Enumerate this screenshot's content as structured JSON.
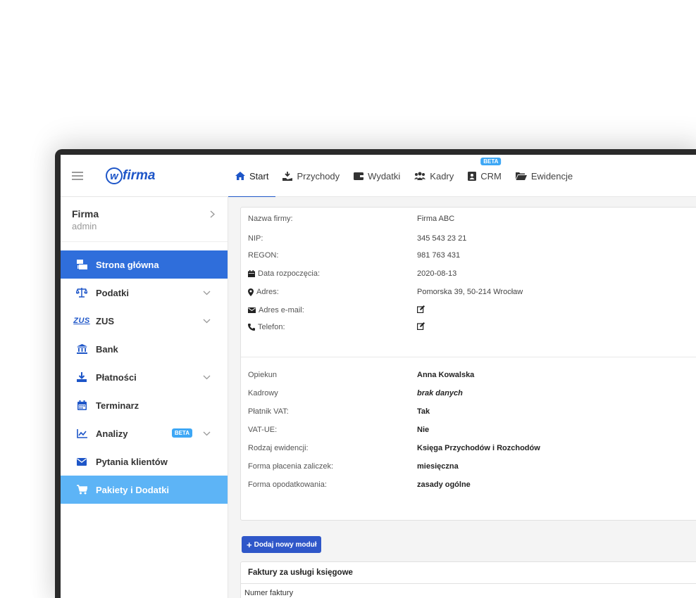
{
  "brand": {
    "logo_mark": "w",
    "logo_text": "firma",
    "color": "#1e56c8"
  },
  "topnav": {
    "tabs": [
      {
        "label": "Start",
        "icon": "home-icon",
        "active": true
      },
      {
        "label": "Przychody",
        "icon": "income-icon"
      },
      {
        "label": "Wydatki",
        "icon": "wallet-icon"
      },
      {
        "label": "Kadry",
        "icon": "users-icon"
      },
      {
        "label": "CRM",
        "icon": "contact-book-icon",
        "badge": "BETA"
      },
      {
        "label": "Ewidencje",
        "icon": "folder-open-icon"
      }
    ]
  },
  "sidebar": {
    "company_name": "Firma",
    "company_role": "admin",
    "items": [
      {
        "label": "Strona główna",
        "icon": "dashboard-icon",
        "state": "active"
      },
      {
        "label": "Podatki",
        "icon": "scales-icon",
        "chevron": true
      },
      {
        "label": "ZUS",
        "icon_text": "ZUS",
        "icon": "zus-logo-icon",
        "chevron": true
      },
      {
        "label": "Bank",
        "icon": "bank-icon"
      },
      {
        "label": "Płatności",
        "icon": "download-icon",
        "chevron": true
      },
      {
        "label": "Terminarz",
        "icon": "calendar-icon"
      },
      {
        "label": "Analizy",
        "icon": "chart-icon",
        "badge": "BETA",
        "chevron": true
      },
      {
        "label": "Pytania klientów",
        "icon": "envelope-icon"
      },
      {
        "label": "Pakiety i Dodatki",
        "icon": "cart-icon",
        "state": "highlight"
      }
    ]
  },
  "company_info": {
    "nazwa_label": "Nazwa firmy:",
    "nazwa_value": "Firma ABC",
    "nip_label": "NIP:",
    "nip_value": "345 543 23 21",
    "regon_label": "REGON:",
    "regon_value": "981 763 431",
    "data_label": "Data rozpoczęcia:",
    "data_value": "2020-08-13",
    "adres_label": "Adres:",
    "adres_value": "Pomorska 39, 50-214 Wrocław",
    "email_label": "Adres e-mail:",
    "telefon_label": "Telefon:"
  },
  "settings": {
    "opiekun_label": "Opiekun",
    "opiekun_value": "Anna Kowalska",
    "kadrowy_label": "Kadrowy",
    "kadrowy_value": "brak danych",
    "vat_label": "Płatnik VAT:",
    "vat_value": "Tak",
    "vatue_label": "VAT-UE:",
    "vatue_value": "Nie",
    "ewidencja_label": "Rodzaj ewidencji:",
    "ewidencja_value": "Księga Przychodów i Rozchodów",
    "zaliczki_label": "Forma płacenia zaliczek:",
    "zaliczki_value": "miesięczna",
    "opodatkowanie_label": "Forma opodatkowania:",
    "opodatkowanie_value": "zasady ogólne"
  },
  "actions": {
    "add_module_label": "Dodaj nowy moduł"
  },
  "invoices": {
    "title": "Faktury za usługi księgowe",
    "col_number": "Numer faktury"
  },
  "colors": {
    "active": "#2f6edb",
    "highlight": "#5db4f6",
    "beta": "#3da7f5",
    "button": "#2f57c9"
  }
}
